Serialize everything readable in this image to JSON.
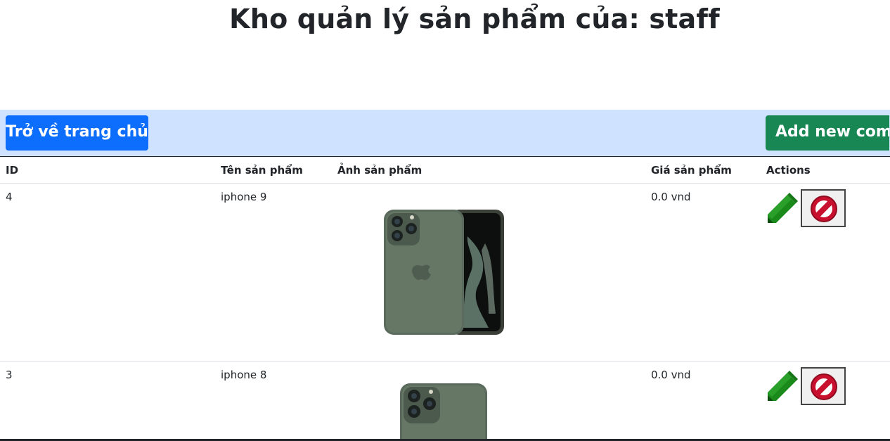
{
  "title": "Kho quản lý sản phẩm của: staff",
  "toolbar": {
    "home_label": "Trở về trang chủ",
    "add_label": "Add new com"
  },
  "table": {
    "columns": [
      "ID",
      "Tên sản phẩm",
      "Ảnh sản phẩm",
      "Giá sản phẩm",
      "Actions"
    ],
    "rows": [
      {
        "id": "4",
        "name": "iphone 9",
        "price": "0.0 vnd"
      },
      {
        "id": "3",
        "name": "iphone 8",
        "price": "0.0 vnd"
      }
    ]
  },
  "icons": {
    "edit": "pencil-icon",
    "delete": "prohibited-icon"
  },
  "colors": {
    "primary": "#0d6efd",
    "success": "#198754",
    "toolbar_bg": "#cfe2ff",
    "edit_icon": "#1a8a1a",
    "delete_icon": "#c8102e"
  }
}
